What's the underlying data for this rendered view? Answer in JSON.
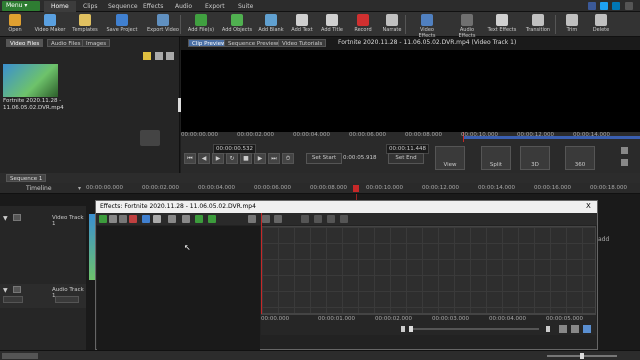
{
  "menubar": {
    "menu_label": "Menu ▾",
    "tabs": [
      {
        "label": "Home",
        "active": true
      },
      {
        "label": "Clips"
      },
      {
        "label": "Sequence"
      },
      {
        "label": "Effects"
      },
      {
        "label": "Audio"
      },
      {
        "label": "Export"
      },
      {
        "label": "Suite"
      }
    ]
  },
  "ribbon": {
    "items": [
      {
        "label": "Open",
        "icon": "folder-icon",
        "color": "#e0a030"
      },
      {
        "label": "Video Maker",
        "icon": "video-maker-icon",
        "color": "#5aa0e0"
      },
      {
        "label": "Templates",
        "icon": "templates-icon",
        "color": "#e0c060"
      },
      {
        "label": "Save Project",
        "icon": "save-icon",
        "color": "#4080d0"
      },
      {
        "label": "Export Video",
        "icon": "export-icon",
        "color": "#6090c0"
      },
      {
        "label": "Add File(s)",
        "icon": "add-files-icon",
        "color": "#40a040"
      },
      {
        "label": "Add Objects",
        "icon": "add-objects-icon",
        "color": "#50b050"
      },
      {
        "label": "Add Blank",
        "icon": "add-blank-icon",
        "color": "#60a0d0"
      },
      {
        "label": "Add Text",
        "icon": "add-text-icon",
        "color": "#d0d0d0"
      },
      {
        "label": "Add Title",
        "icon": "add-title-icon",
        "color": "#d0d0d0"
      },
      {
        "label": "Record",
        "icon": "record-icon",
        "color": "#d03030"
      },
      {
        "label": "Narrate",
        "icon": "narrate-icon",
        "color": "#c0c0c0"
      },
      {
        "label": "Video Effects",
        "icon": "video-effects-icon",
        "color": "#5080c0"
      },
      {
        "label": "Audio Effects",
        "icon": "audio-effects-icon",
        "color": "#707070"
      },
      {
        "label": "Text Effects",
        "icon": "text-effects-icon",
        "color": "#d0d0d0"
      },
      {
        "label": "Transition",
        "icon": "transition-icon",
        "color": "#c0c0c0"
      },
      {
        "label": "Trim",
        "icon": "trim-icon",
        "color": "#c0c0c0"
      },
      {
        "label": "Delete",
        "icon": "delete-icon",
        "color": "#c0c0c0"
      }
    ]
  },
  "media": {
    "tabs": [
      "Video Files",
      "Audio Files",
      "Images"
    ],
    "clip_label": "Fortnite 2020.11.28 - 11.06.05.02.DVR.mp4"
  },
  "preview": {
    "tabs": [
      "Clip Preview",
      "Sequence Preview",
      "Video Tutorials"
    ],
    "title": "Fortnite 2020.11.28 - 11.06.05.02.DVR.mp4 (Video Track 1)",
    "ruler": [
      "00:00:00.000",
      "00:00:02.000",
      "00:00:04.000",
      "00:00:06.000",
      "00:00:08.000",
      "00:00:10.000",
      "00:00:12.000",
      "00:00:14.000"
    ],
    "start_time": "00:00:00.532",
    "end_time": "00:00:11.448",
    "duration": "0:00:05.918",
    "set_start": "Set Start",
    "set_end": "Set End",
    "view_label": "View",
    "split_label": "Split",
    "three_d_label": "3D",
    "three_sixty_label": "360"
  },
  "sequence": {
    "tab": "Sequence 1",
    "timeline_label": "Timeline",
    "ruler": [
      "00:00:00.000",
      "00:00:02.000",
      "00:00:04.000",
      "00:00:06.000",
      "00:00:08.000",
      "00:00:10.000",
      "00:00:12.000",
      "00:00:14.000",
      "00:00:16.000",
      "00:00:18.000"
    ],
    "video_track": "Video Track 1",
    "audio_track": "Audio Track 1",
    "add_label": "add"
  },
  "dialog": {
    "title": "Effects: Fortnite 2020.11.28 - 11.06.05.02.DVR.mp4",
    "close": "X",
    "ruler": [
      "00:00.000",
      "00:00:01.000",
      "00:00:02.000",
      "00:00:03.000",
      "00:00:04.000",
      "00:00:05.000"
    ]
  }
}
